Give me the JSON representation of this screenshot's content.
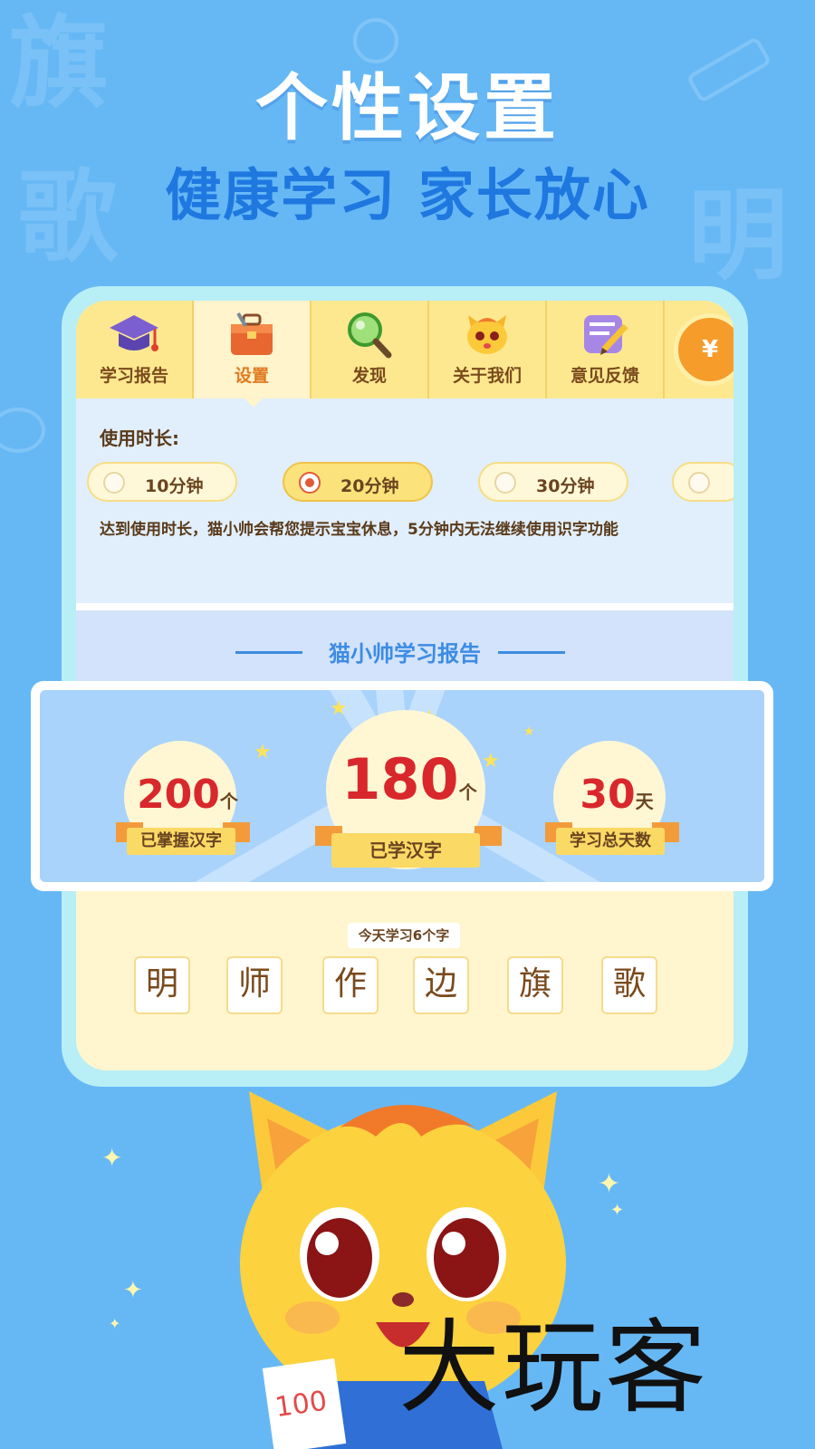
{
  "header": {
    "title": "个性设置",
    "subtitle": "健康学习 家长放心"
  },
  "background_chars": [
    "旗",
    "歌",
    "明"
  ],
  "tabs": [
    {
      "label": "学习报告",
      "icon": "graduation-cap-icon"
    },
    {
      "label": "设置",
      "icon": "toolbox-icon",
      "active": true
    },
    {
      "label": "发现",
      "icon": "magnifier-icon"
    },
    {
      "label": "关于我们",
      "icon": "cat-face-icon"
    },
    {
      "label": "意见反馈",
      "icon": "feedback-pencil-icon"
    }
  ],
  "coin_symbol": "¥",
  "settings": {
    "duration_label": "使用时长:",
    "options": [
      {
        "label": "10分钟",
        "selected": false
      },
      {
        "label": "20分钟",
        "selected": true
      },
      {
        "label": "30分钟",
        "selected": false
      }
    ],
    "note": "达到使用时长，猫小帅会帮您提示宝宝休息，5分钟内无法继续使用识字功能"
  },
  "report": {
    "title": "猫小帅学习报告",
    "stats": [
      {
        "value": "200",
        "unit": "个",
        "label": "已掌握汉字"
      },
      {
        "value": "180",
        "unit": "个",
        "label": "已学汉字"
      },
      {
        "value": "30",
        "unit": "天",
        "label": "学习总天数"
      }
    ],
    "today_label": "今天学习6个字",
    "today_chars": [
      "明",
      "师",
      "作",
      "边",
      "旗",
      "歌"
    ]
  },
  "mascot": {
    "sign_text": "100"
  },
  "watermark": "大玩客",
  "colors": {
    "background": "#66b8f5",
    "subtitle": "#1f78e0",
    "number_red": "#d8282c",
    "tab_yellow": "#fde890"
  }
}
